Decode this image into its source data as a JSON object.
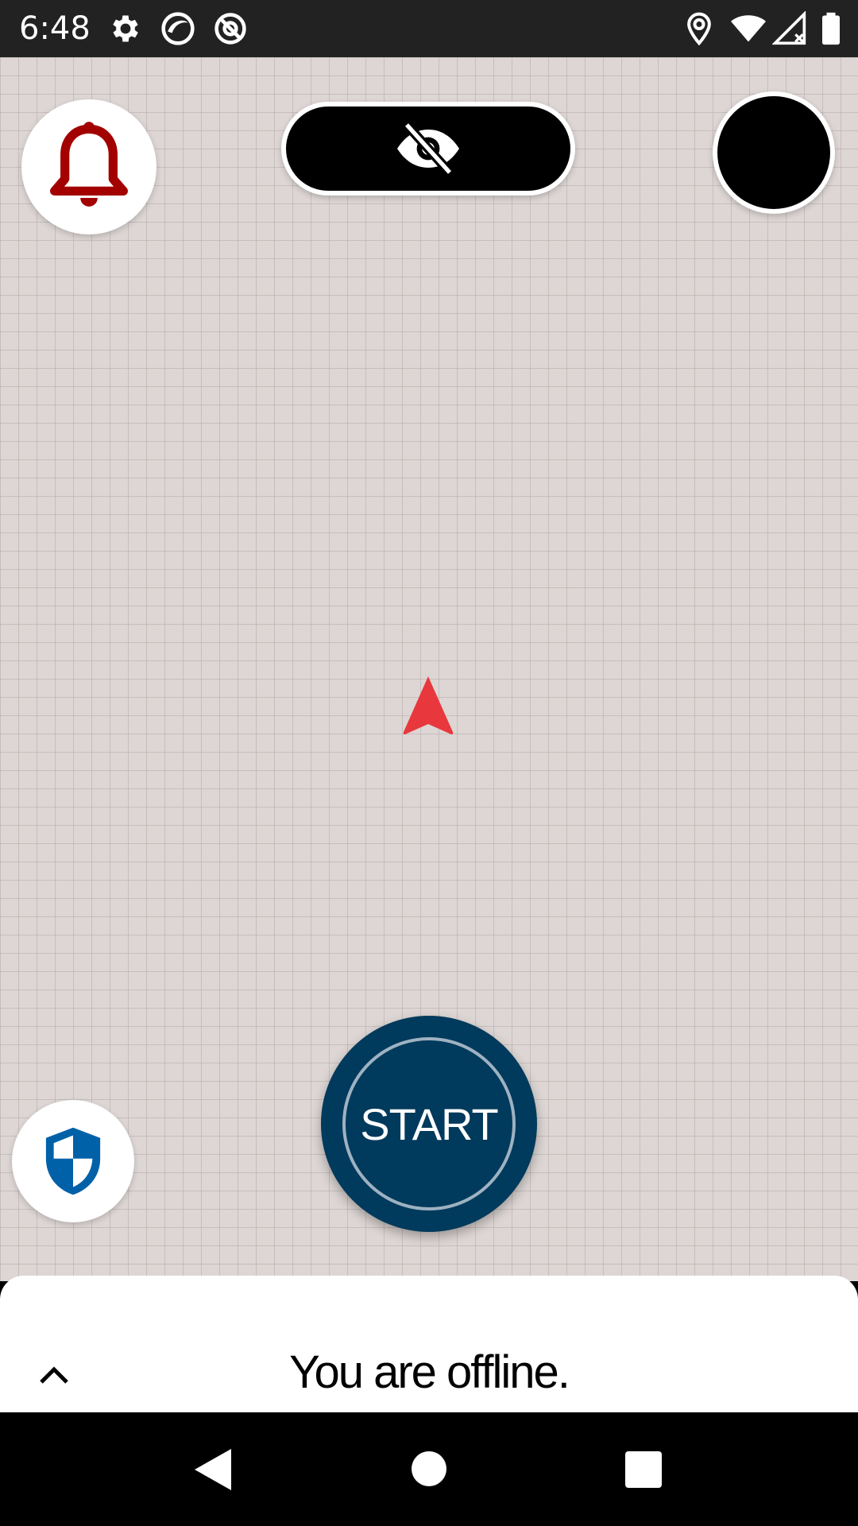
{
  "status_bar": {
    "time": "6:48",
    "icons": [
      "gear-icon",
      "app-icon",
      "at-sign-off-icon",
      "location-icon",
      "wifi-icon",
      "signal-icon",
      "battery-icon"
    ]
  },
  "map": {
    "notification_icon": "bell-icon",
    "visibility_icon": "eye-off-icon",
    "location_marker": "navigation-arrow-icon",
    "safety_icon": "shield-icon",
    "start_label": "START",
    "colors": {
      "map_bg": "#ddd6d4",
      "bell": "#a30000",
      "start_button": "#003a5c",
      "shield": "#0061a8",
      "arrow": "#e8383d"
    }
  },
  "bottom_sheet": {
    "title": "You are offline.",
    "expand_icon": "chevron-up-icon"
  },
  "nav_bar": {
    "buttons": [
      "back-icon",
      "home-icon",
      "recents-icon"
    ]
  }
}
